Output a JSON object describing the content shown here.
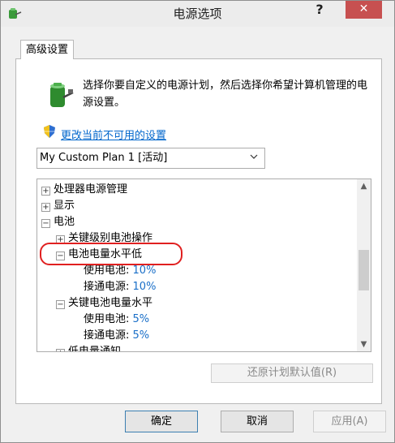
{
  "window": {
    "title": "电源选项",
    "help_label": "?",
    "close_label": "✕"
  },
  "tab": {
    "label": "高级设置"
  },
  "description": "选择你要自定义的电源计划，然后选择你希望计算机管理的电源设置。",
  "change_link": "更改当前不可用的设置",
  "plan_select": {
    "value": "My Custom Plan 1 [活动]"
  },
  "tree": {
    "items": [
      {
        "expander": "⊞",
        "label": "处理器电源管理"
      },
      {
        "expander": "⊞",
        "label": "显示"
      },
      {
        "expander": "⊟",
        "label": "电池"
      },
      {
        "expander": "⊞",
        "label": "关键级别电池操作"
      },
      {
        "expander": "⊟",
        "label": "电池电量水平低"
      },
      {
        "label": "使用电池:",
        "value": "10%"
      },
      {
        "label": "接通电源:",
        "value": "10%"
      },
      {
        "expander": "⊟",
        "label": "关键电池电量水平"
      },
      {
        "label": "使用电池:",
        "value": "5%"
      },
      {
        "label": "接通电源:",
        "value": "5%"
      },
      {
        "expander": "⊞",
        "label": "低电量通知"
      }
    ]
  },
  "restore_button": "还原计划默认值(R)",
  "buttons": {
    "ok": "确定",
    "cancel": "取消",
    "apply": "应用(A)"
  },
  "colors": {
    "close_button": "#c75050",
    "link": "#0066cc",
    "highlight_ring": "#e02020",
    "setting_value": "#1a6fc8"
  }
}
